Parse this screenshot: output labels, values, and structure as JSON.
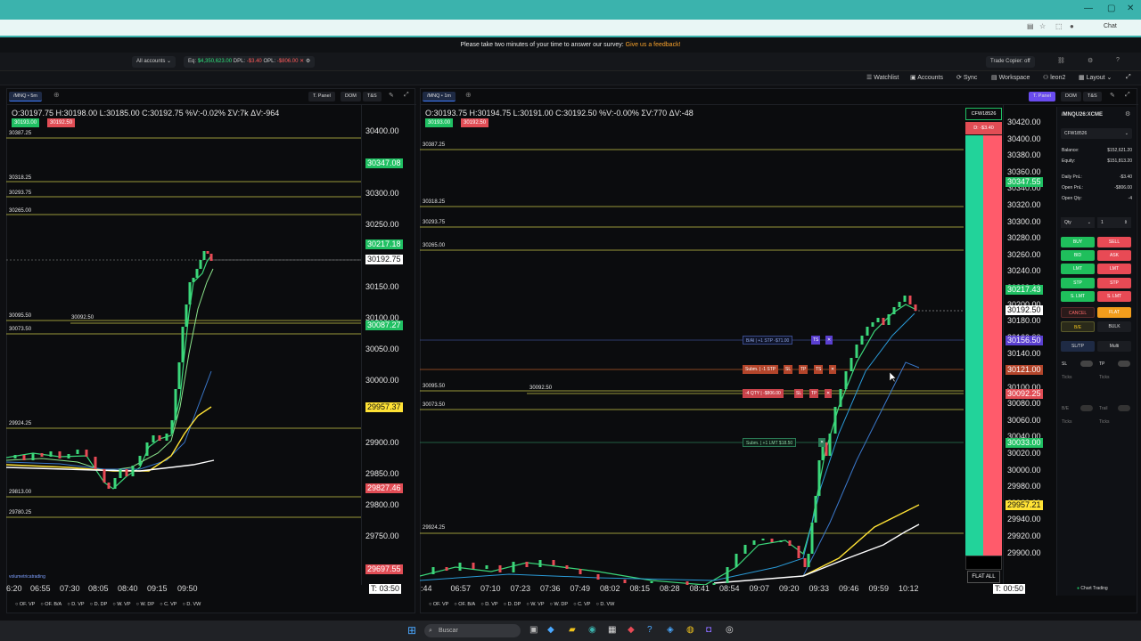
{
  "browser": {
    "chat_label": "Chat"
  },
  "survey": {
    "text": "Please take two minutes of your time to answer our survey:",
    "link": "Give us a feedback!"
  },
  "account_bar": {
    "accounts": "All accounts",
    "eq_label": "Eq:",
    "eq_value": "$4,350,623.00",
    "dpl_label": "DPL:",
    "dpl_value": "-$3.40",
    "opl_label": "OPL:",
    "opl_value": "-$806.00",
    "trade_copier": "Trade Copier: off"
  },
  "nav": {
    "watchlist": "Watchlist",
    "accounts": "Accounts",
    "sync": "Sync",
    "workspace": "Workspace",
    "user": "leon2",
    "layout": "Layout"
  },
  "left_chart": {
    "tab": "/MNQ • 5m",
    "tpanel": "T. Panel",
    "dom": "DOM",
    "ts": "T&S",
    "ohlc": "O:30197.75  H:30198.00  L:30185.00  C:30192.75  %V:-0.02%  ΣV:7k  ΔV:-964",
    "bid_badge": "30193.00",
    "ask_badge": "30192.50",
    "levels": [
      "30387.25",
      "30318.25",
      "30293.75",
      "30265.00",
      "30095.50",
      "30092.50",
      "30073.50",
      "29924.25",
      "29813.00",
      "29780.25"
    ],
    "yaxis": [
      "30400.00",
      "30300.00",
      "30250.00",
      "30150.00",
      "30100.00",
      "30050.00",
      "30000.00",
      "29900.00",
      "29850.00",
      "29800.00",
      "29750.00"
    ],
    "tags": {
      "t1": "30347.08",
      "t2": "30217.18",
      "t3": "30192.75",
      "t4": "30087.27",
      "t5": "29957.37",
      "t6": "29827.46",
      "t7": "29697.55"
    },
    "xaxis": [
      "6:20",
      "06:55",
      "07:30",
      "08:05",
      "08:40",
      "09:15",
      "09:50"
    ],
    "timer": "T: 03:50",
    "brand": "volumetricatrading",
    "footer": [
      "OF. VP",
      "OF. B/A",
      "D. VP",
      "D. DP",
      "W. VP",
      "W. DP",
      "C. VP",
      "D. VW"
    ]
  },
  "right_chart": {
    "tab": "/MNQ • 1m",
    "tpanel": "T. Panel",
    "dom": "DOM",
    "ts": "T&S",
    "ohlc": "O:30193.75  H:30194.75  L:30191.00  C:30192.50  %V:-0.00%  ΣV:770  ΔV:-48",
    "bid_badge": "30193.00",
    "ask_badge": "30192.50",
    "levels": [
      "30387.25",
      "30318.25",
      "30293.75",
      "30265.00",
      "30095.50",
      "30092.50",
      "30073.50",
      "29924.25"
    ],
    "yaxis": [
      "30420.00",
      "30400.00",
      "30380.00",
      "30360.00",
      "30340.00",
      "30320.00",
      "30300.00",
      "30280.00",
      "30260.00",
      "30240.00",
      "30220.00",
      "30200.00",
      "30180.00",
      "30160.00",
      "30140.00",
      "30120.00",
      "30100.00",
      "30080.00",
      "30060.00",
      "30040.00",
      "30020.00",
      "30000.00",
      "29980.00",
      "29960.00",
      "29940.00",
      "29920.00",
      "29900.00"
    ],
    "tags": {
      "t1": "30347.55",
      "t2": "30217.43",
      "t3": "30192.50",
      "t4": "30156.50",
      "t5": "30121.00",
      "t6": "30092.25",
      "t7": "30033.00",
      "t8": "29957.21"
    },
    "xaxis": [
      ":44",
      "06:57",
      "07:10",
      "07:23",
      "07:36",
      "07:49",
      "08:02",
      "08:15",
      "08:28",
      "08:41",
      "08:54",
      "09:07",
      "09:20",
      "09:33",
      "09:46",
      "09:59",
      "10:12"
    ],
    "timer": "T: 00:50",
    "orders": {
      "o1": "B/Al | +1 STP",
      "o1b": "-$71.00",
      "o2": "Subm. | -1 STP",
      "o3": "-4 QTY | -$806.00",
      "o4": "Subm. | +1 LMT",
      "o4b": "$18.50"
    },
    "dom_account": "CFW18526",
    "dom_pnl": "D: -$3.40",
    "flat_all": "FLAT ALL",
    "footer": [
      "OF. VP",
      "OF. B/A",
      "D. VP",
      "D. DP",
      "W. VP",
      "W. DP",
      "C. VP",
      "D. VW"
    ]
  },
  "sidebar": {
    "symbol": "/MNQU26:XCME",
    "account": "CFW18526",
    "balance_label": "Balance:",
    "balance": "$152,621.20",
    "equity_label": "Equity:",
    "equity": "$151,813.20",
    "daily_label": "Daily PnL:",
    "daily": "-$3.40",
    "open_label": "Open PnL:",
    "open": "-$806.00",
    "qty_label": "Open Qty:",
    "qty": "-4",
    "qty_select": "Qty",
    "qty_value": "1",
    "buttons": {
      "buy": "BUY",
      "sell": "SELL",
      "bid": "BID",
      "ask": "ASK",
      "lmt1": "LMT",
      "lmt2": "LMT",
      "stp1": "STP",
      "stp2": "STP",
      "slmt1": "S. LMT",
      "slmt2": "S. LMT",
      "cancel": "CANCEL",
      "flat": "FLAT",
      "be": "B/E",
      "bulk": "BULK"
    },
    "tabs": {
      "sltp": "SL/TP",
      "multi": "Multi"
    },
    "sl": "SL",
    "tp": "TP",
    "ticks": "Ticks",
    "be2": "B/E",
    "trail": "Trail",
    "chart_trading": "Chart Trading"
  },
  "taskbar": {
    "search": "Buscar"
  }
}
